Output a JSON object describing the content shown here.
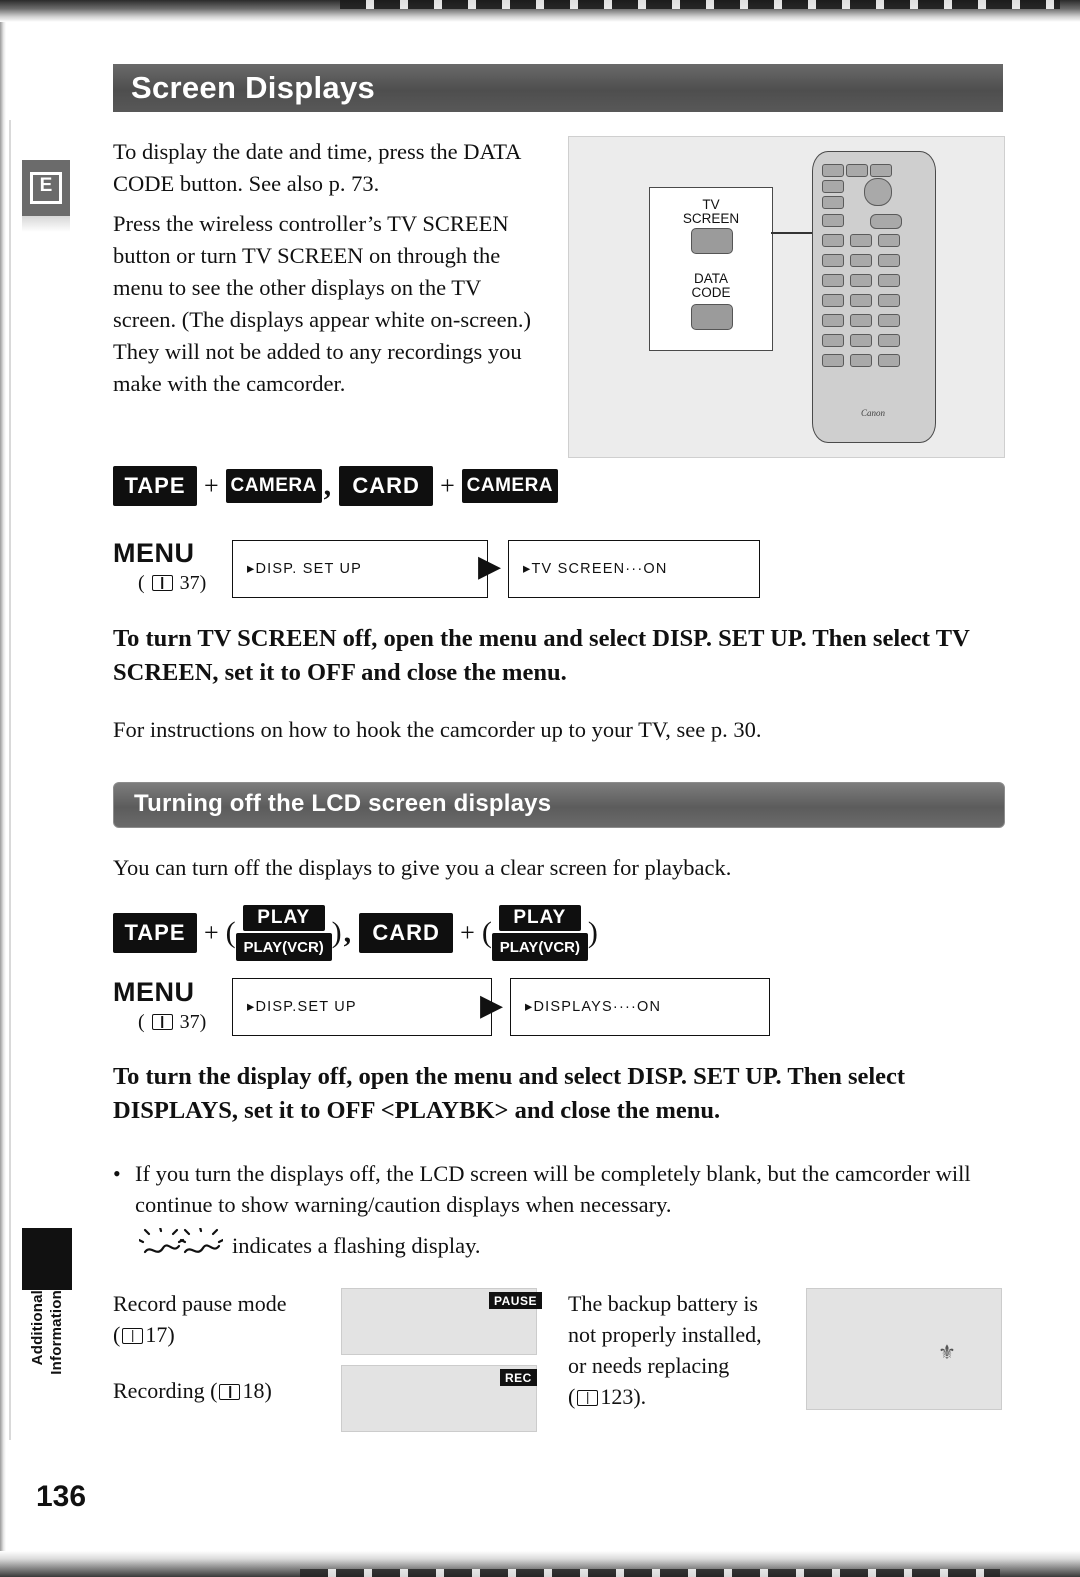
{
  "page": {
    "number": "136",
    "title": "Screen Displays",
    "tab_letter": "E",
    "side_label_top": "Additional",
    "side_label_bottom": "Information"
  },
  "intro": {
    "p1": "To display the date and time, press the DATA CODE button. See also p. 73.",
    "p2": "Press the wireless controller’s TV SCREEN button or turn TV SCREEN on through the menu to see the other displays on the TV screen. (The displays appear white on-screen.) They will not be added to any recordings you make with the camcorder."
  },
  "remote": {
    "callout_tv_line1": "TV",
    "callout_tv_line2": "SCREEN",
    "callout_data_line1": "DATA",
    "callout_data_line2": "CODE",
    "brand": "Canon"
  },
  "section1": {
    "modes": {
      "tape": "TAPE",
      "camera1": "CAMERA",
      "card": "CARD",
      "camera2": "CAMERA",
      "plus": "+",
      "comma": ","
    },
    "menu": {
      "label": "MENU",
      "ref_prefix": "(",
      "ref_page": "37)",
      "field1": "▸DISP. SET UP",
      "arrow": "▶",
      "field2": "▸TV SCREEN···ON"
    },
    "bold_note": "To turn TV SCREEN off, open the menu and select DISP. SET UP. Then select TV SCREEN, set it to OFF and close the menu.",
    "footnote": "For instructions on how to hook the camcorder up to your TV, see p. 30."
  },
  "section2": {
    "heading": "Turning off the LCD screen displays",
    "intro": "You can turn off the displays to give you a clear screen for playback.",
    "modes": {
      "tape": "TAPE",
      "card": "CARD",
      "play": "PLAY",
      "playvcr": "PLAY(VCR)",
      "plus": "+",
      "comma": ",",
      "paren_open": "(",
      "paren_close": ")"
    },
    "menu": {
      "label": "MENU",
      "ref_prefix": "(",
      "ref_page": "37)",
      "field1": "▸DISP.SET UP",
      "arrow": "▶",
      "field2": "▸DISPLAYS····ON"
    },
    "bold_note": "To turn the display off, open the menu and select DISP. SET UP. Then select DISPLAYS, set it to OFF <PLAYBK> and close the menu.",
    "bullet": "If you turn the displays off, the LCD screen will be completely blank, but the camcorder will continue to show warning/caution displays when necessary.",
    "flash_note": "indicates a flashing display."
  },
  "examples": [
    {
      "label_line1": "Record pause mode",
      "label_line2_prefix": "(",
      "label_line2_page": "17)",
      "tag": "PAUSE"
    },
    {
      "label_line1": "Recording (",
      "label_line2_page": "18)",
      "tag": "REC"
    },
    {
      "label_line1": "The backup battery is",
      "label_line2": "not properly installed,",
      "label_line3": "or needs replacing",
      "label_line4_prefix": "(",
      "label_line4_page": "123).",
      "tag": ""
    }
  ]
}
